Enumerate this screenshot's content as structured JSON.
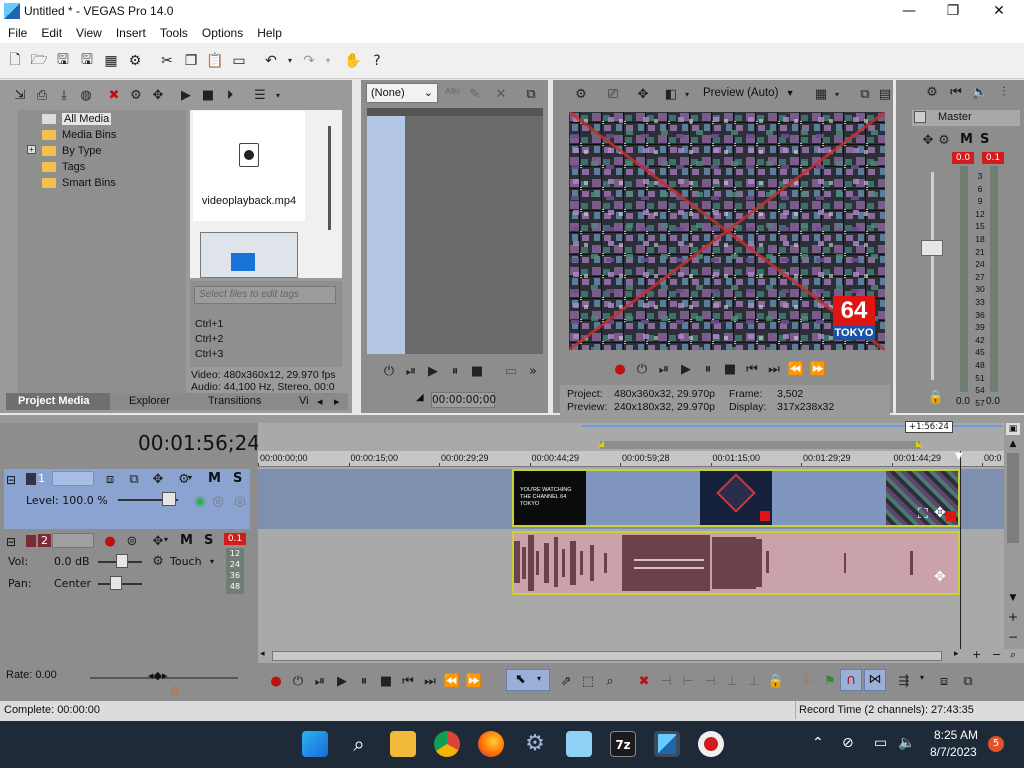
{
  "window": {
    "title": "Untitled * - VEGAS Pro 14.0",
    "minimize": "—",
    "maximize": "❐",
    "close": "✕"
  },
  "menu": [
    "File",
    "Edit",
    "View",
    "Insert",
    "Tools",
    "Options",
    "Help"
  ],
  "project_media": {
    "tree": [
      "All Media",
      "Media Bins",
      "By Type",
      "Tags",
      "Smart Bins"
    ],
    "expand_marker": "+",
    "file_name": "videoplayback.mp4",
    "tags_placeholder": "Select files to edit tags",
    "shortcuts": [
      "Ctrl+1",
      "Ctrl+2",
      "Ctrl+3"
    ],
    "video_info": "Video: 480x360x12, 29.970 fps",
    "audio_info": "Audio: 44,100 Hz, Stereo, 00:0",
    "tabs": [
      "Project Media",
      "Explorer",
      "Transitions",
      "Vi"
    ]
  },
  "trimmer": {
    "dropdown": "(None)",
    "timecode": "00:00:00;00"
  },
  "preview": {
    "quality": "Preview (Auto)",
    "logo_number": "64",
    "logo_text": "TOKYO",
    "project_label": "Project:",
    "project_value": "480x360x32, 29.970p",
    "preview_label": "Preview:",
    "preview_value": "240x180x32, 29.970p",
    "frame_label": "Frame:",
    "frame_value": "3,502",
    "display_label": "Display:",
    "display_value": "317x238x32"
  },
  "master": {
    "label": "Master",
    "m": "M",
    "s": "S",
    "peak_left": "0.0",
    "peak_right": "0.1",
    "scale": [
      "3",
      "6",
      "9",
      "12",
      "15",
      "18",
      "21",
      "24",
      "27",
      "30",
      "33",
      "36",
      "39",
      "42",
      "45",
      "48",
      "51",
      "54",
      "57"
    ],
    "bottom_left": "0.0",
    "bottom_right": "0.0"
  },
  "timeline": {
    "current_time": "00:01:56;24",
    "loop_label": "+1:56:24",
    "ruler": [
      "00:00:00;00",
      "00:00:15;00",
      "00:00:29;29",
      "00:00:44;29",
      "00:00:59;28",
      "00:01:15;00",
      "00:01:29;29",
      "00:01:44;29",
      "00:0"
    ],
    "clip_text": "YOU'RE WATCHING THE CHANNEL 64 TOKYO"
  },
  "tracks": {
    "video": {
      "number": "1",
      "m": "M",
      "s": "S",
      "level": "Level: 100.0 %"
    },
    "audio": {
      "number": "2",
      "m": "M",
      "s": "S",
      "peak": "0.1",
      "vol_label": "Vol:",
      "vol_value": "0.0 dB",
      "pan_label": "Pan:",
      "pan_value": "Center",
      "mode": "Touch",
      "meter_marks": [
        "12",
        "24",
        "36",
        "48"
      ]
    }
  },
  "transport": {
    "rate": "Rate: 0.00"
  },
  "status": {
    "complete": "Complete: 00:00:00",
    "record_time": "Record Time (2 channels): 27:43:35"
  },
  "taskbar": {
    "time": "8:25 AM",
    "date": "8/7/2023",
    "badge": "5"
  },
  "colors": {
    "video_track": "#7f8fb0",
    "audio_track": "#c9a3a9",
    "video_header": "#8aa3d0",
    "accent_red": "#d21c1c"
  }
}
